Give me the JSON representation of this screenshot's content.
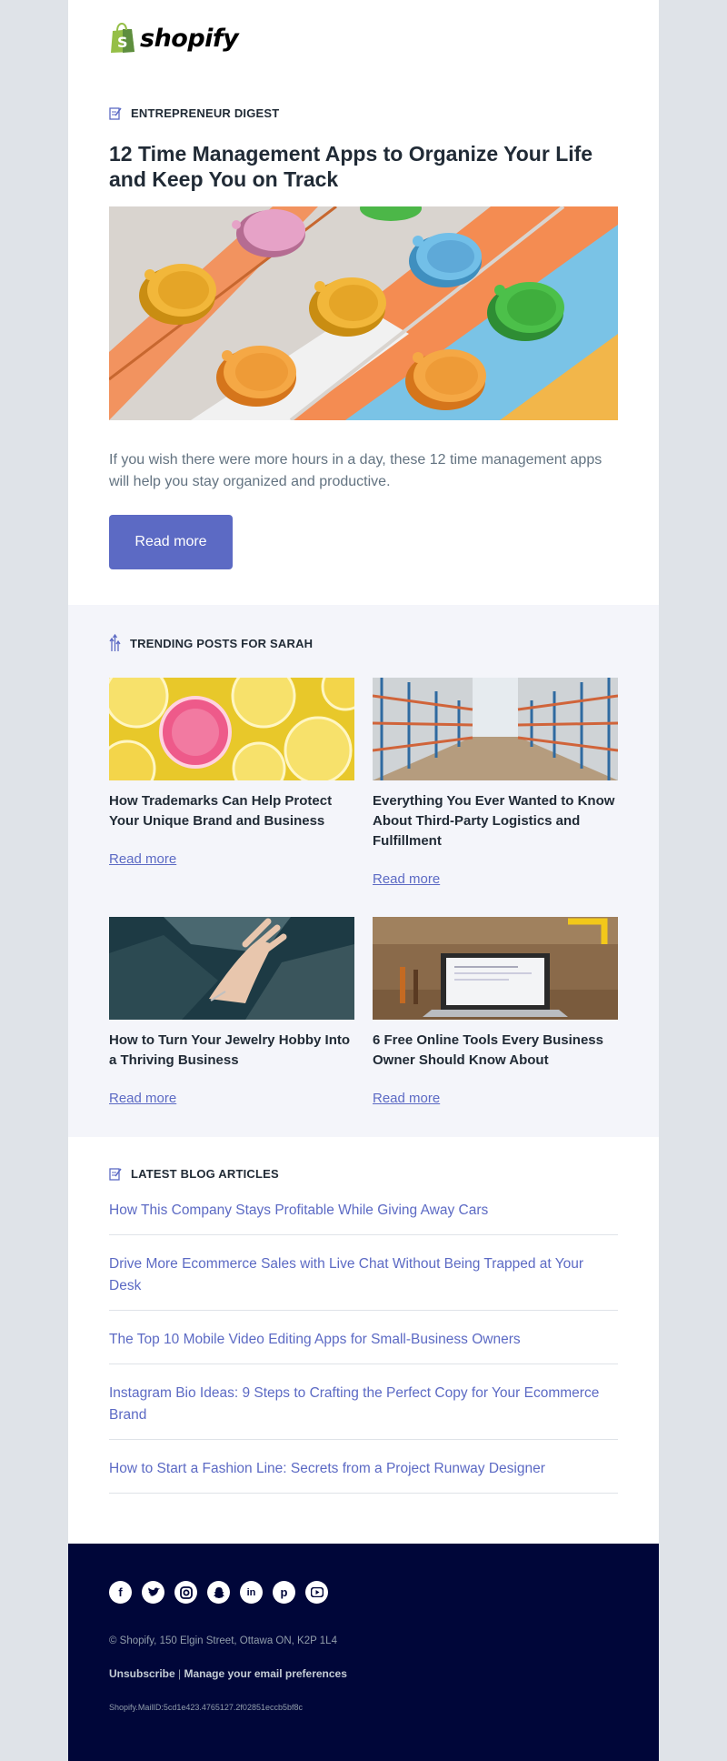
{
  "header": {
    "logo_text": "shopify"
  },
  "hero": {
    "section_label": "ENTREPRENEUR DIGEST",
    "title": "12 Time Management Apps to Organize Your Life and Keep You on Track",
    "description": "If you wish there were more hours in a day, these 12 time management apps will help you stay organized and productive.",
    "button_label": "Read more"
  },
  "trending": {
    "section_label": "TRENDING POSTS FOR SARAH",
    "posts": [
      {
        "title": "How Trademarks Can Help Protect Your Unique Brand and Business",
        "link": "Read more",
        "image": "lemons"
      },
      {
        "title": "Everything You Ever Wanted to Know About Third-Party Logistics and Fulfillment",
        "link": "Read more",
        "image": "warehouse"
      },
      {
        "title": "How to Turn Your Jewelry Hobby Into a Thriving Business",
        "link": "Read more",
        "image": "hand-on-rock"
      },
      {
        "title": "6 Free Online Tools Every Business Owner Should Know About",
        "link": "Read more",
        "image": "laptop-workbench"
      }
    ]
  },
  "latest": {
    "section_label": "LATEST BLOG ARTICLES",
    "articles": [
      "How This Company Stays Profitable While Giving Away Cars",
      "Drive More Ecommerce Sales with Live Chat Without Being Trapped at Your Desk",
      "The Top 10 Mobile Video Editing Apps for Small-Business Owners",
      "Instagram Bio Ideas: 9 Steps to Crafting the Perfect Copy for Your Ecommerce Brand",
      "How to Start a Fashion Line: Secrets from a Project Runway Designer"
    ]
  },
  "footer": {
    "social_icons": [
      "facebook-icon",
      "twitter-icon",
      "instagram-icon",
      "snapchat-icon",
      "linkedin-icon",
      "pinterest-icon",
      "youtube-icon"
    ],
    "address": "© Shopify,  150 Elgin Street, Ottawa ON, K2P 1L4",
    "unsubscribe": "Unsubscribe",
    "separator": "|",
    "manage_prefs": "Manage your email preferences",
    "mail_id": "Shopify.MailID:5cd1e423.4765127.2f02851eccb5bf8c"
  },
  "colors": {
    "accent": "#5c6ac4",
    "footer_bg": "#000639",
    "trend_bg": "#f4f5fa",
    "page_bg": "#dfe3e8",
    "brand_green": "#95bf47"
  }
}
